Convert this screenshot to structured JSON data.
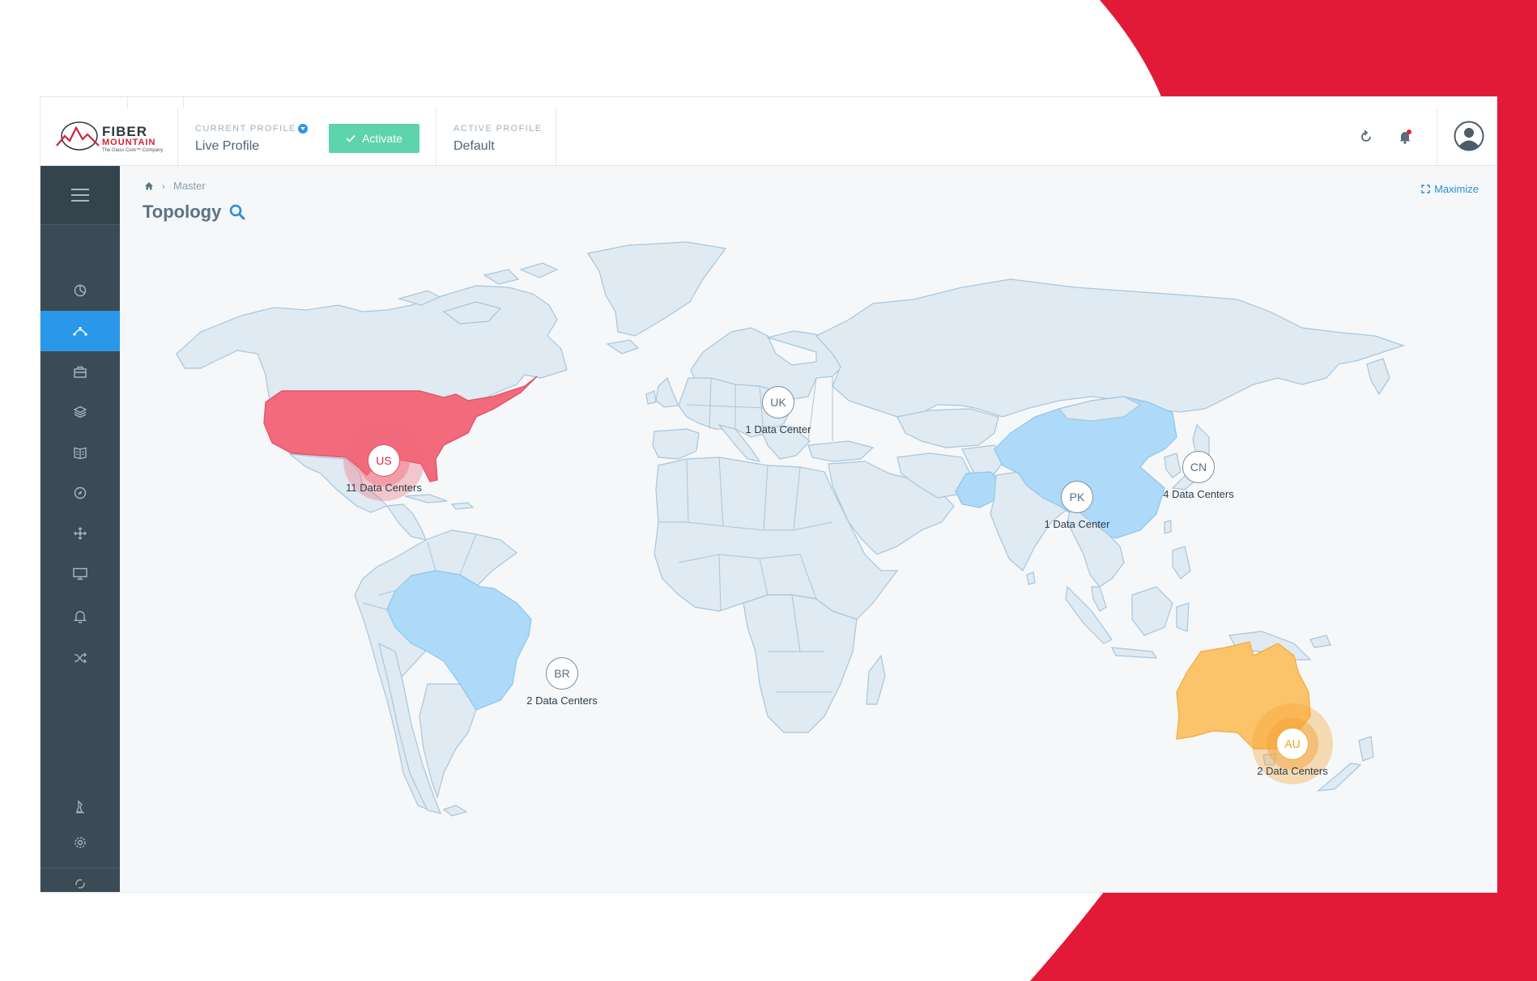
{
  "brand": {
    "name_line1": "FIBER",
    "name_line2": "MOUNTAIN",
    "tagline": "The Glass Core™ Company",
    "accent_color": "#e2233b"
  },
  "header": {
    "current_profile_label": "CURRENT PROFILE",
    "current_profile_value": "Live Profile",
    "activate_label": "Activate",
    "active_profile_label": "ACTIVE PROFILE",
    "active_profile_value": "Default",
    "icons": [
      "refresh-icon",
      "bell-icon",
      "user-avatar-icon"
    ]
  },
  "sidebar": {
    "menu_icon": "hamburger-menu-icon",
    "items": [
      {
        "icon": "pie-chart-icon",
        "active": false
      },
      {
        "icon": "topology-icon",
        "active": true
      },
      {
        "icon": "briefcase-icon",
        "active": false
      },
      {
        "icon": "layers-icon",
        "active": false
      },
      {
        "icon": "book-icon",
        "active": false
      },
      {
        "icon": "compass-icon",
        "active": false
      },
      {
        "icon": "move-icon",
        "active": false
      },
      {
        "icon": "monitor-icon",
        "active": false
      },
      {
        "icon": "bell-icon",
        "active": false
      },
      {
        "icon": "shuffle-icon",
        "active": false
      }
    ],
    "bottom_items": [
      {
        "icon": "chess-piece-icon"
      },
      {
        "icon": "settings-icon"
      },
      {
        "icon": "sync-icon"
      }
    ],
    "active_color": "#2b97e8"
  },
  "breadcrumb": {
    "home_icon": "home-icon",
    "items": [
      "Master"
    ]
  },
  "page": {
    "title": "Topology",
    "maximize_label": "Maximize"
  },
  "map": {
    "highlight_colors": {
      "critical": "#f26a7c",
      "warning": "#fbc46b",
      "normal": "#aedaf9"
    },
    "markers": [
      {
        "code": "US",
        "label": "11 Data Centers",
        "status": "critical"
      },
      {
        "code": "UK",
        "label": "1 Data Center",
        "status": "normal"
      },
      {
        "code": "CN",
        "label": "4 Data Centers",
        "status": "normal"
      },
      {
        "code": "PK",
        "label": "1 Data Center",
        "status": "normal"
      },
      {
        "code": "BR",
        "label": "2 Data Centers",
        "status": "normal"
      },
      {
        "code": "AU",
        "label": "2 Data Centers",
        "status": "warning"
      }
    ]
  }
}
